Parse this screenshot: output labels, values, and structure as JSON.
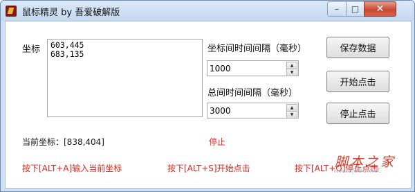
{
  "window": {
    "title": "鼠标精灵 by 吾爱破解版",
    "min_glyph": "–",
    "max_glyph": "□",
    "close_glyph": "✕"
  },
  "coords": {
    "label": "坐标",
    "lines": [
      "603,445",
      "683,135"
    ]
  },
  "interval": {
    "label": "坐标间时间间隔（毫秒）",
    "value": "1000"
  },
  "total": {
    "label": "总间时间间隔（毫秒）",
    "value": "3000"
  },
  "buttons": {
    "save": "保存数据",
    "start": "开始点击",
    "stop": "停止点击"
  },
  "status": {
    "current_label": "当前坐标：[838,404]",
    "state": "停止"
  },
  "hints": {
    "input": "按下[ALT+A]输入当前坐标",
    "start": "按下[ALT+S]开始点击",
    "stop": "按下[ALT+Q]停止点击"
  },
  "watermark": {
    "cn": "脚本之家",
    "url": "www.jb51.net"
  },
  "icons": {
    "up": "▲",
    "down": "▼"
  }
}
